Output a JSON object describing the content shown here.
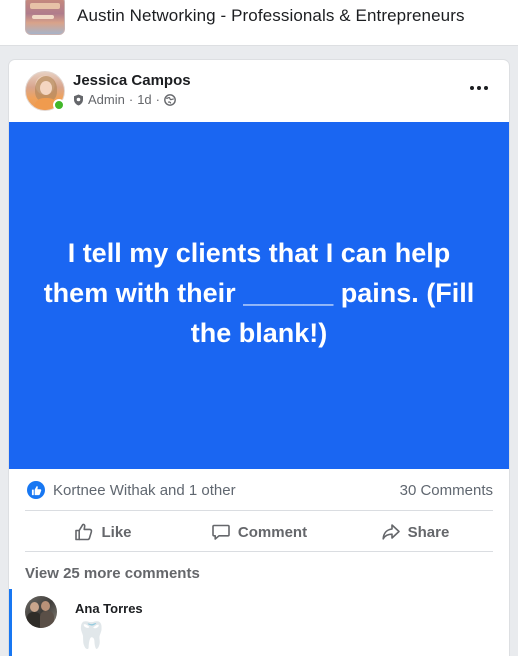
{
  "group": {
    "title": "Austin Networking - Professionals & Entrepreneurs",
    "thumbnail_icon": "group-cover-thumbnail"
  },
  "post": {
    "author": "Jessica Campos",
    "role": "Admin",
    "time": "1d",
    "separator": "·",
    "audience_icon": "globe-icon",
    "image_background": "#1a66f2",
    "image_text": "I tell my clients that I can help them with their ______ pains. (Fill the blank!)"
  },
  "reactions": {
    "summary": "Kortnee Withak and 1 other",
    "comments_count": "30 Comments",
    "like_color": "#1877f2"
  },
  "actions": {
    "like": "Like",
    "comment": "Comment",
    "share": "Share"
  },
  "comments": {
    "view_more": "View 25 more comments",
    "items": [
      {
        "author": "Ana Torres",
        "text": "🦷"
      }
    ]
  }
}
